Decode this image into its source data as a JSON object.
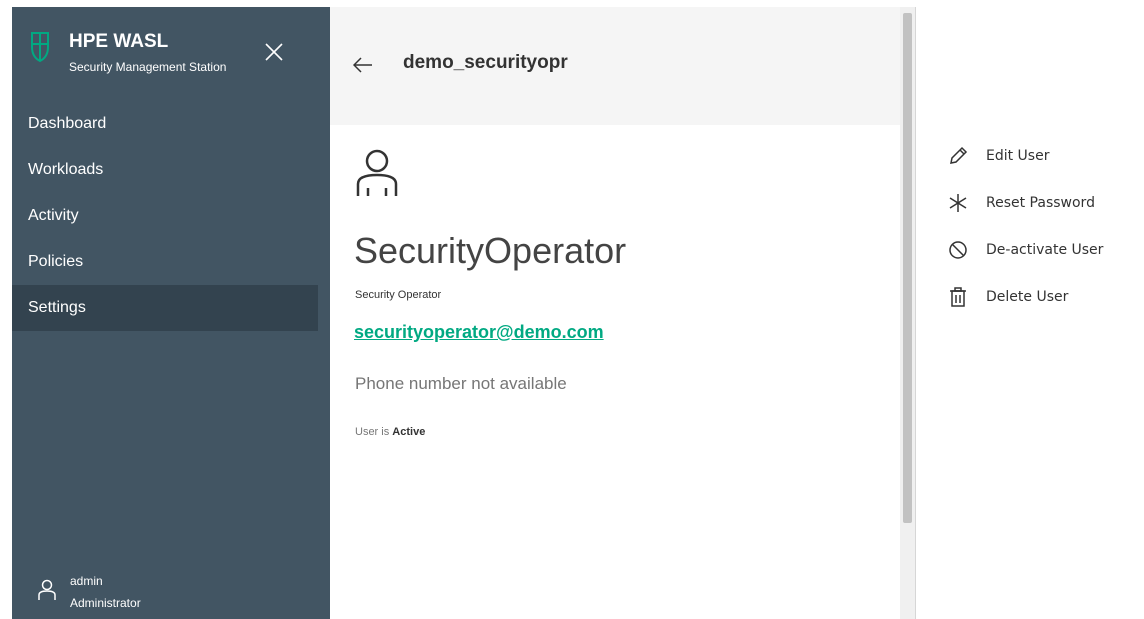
{
  "sidebar": {
    "brand_title": "HPE WASL",
    "brand_subtitle": "Security Management Station",
    "nav": [
      "Dashboard",
      "Workloads",
      "Activity",
      "Policies",
      "Settings"
    ],
    "active_item": "Settings",
    "user": {
      "name": "admin",
      "role": "Administrator"
    }
  },
  "header": {
    "title": "demo_securityopr"
  },
  "profile": {
    "name": "SecurityOperator",
    "role": "Security Operator",
    "email": "securityoperator@demo.com",
    "phone": "Phone number not available",
    "status_prefix": "User is",
    "status": "Active"
  },
  "actions": {
    "edit": "Edit User",
    "reset": "Reset Password",
    "deactivate": "De-activate User",
    "delete": "Delete User"
  },
  "icons": {
    "brand": "shield-icon",
    "close": "close-icon",
    "back": "arrow-left-icon",
    "user": "user-icon",
    "edit": "pencil-icon",
    "reset": "asterisk-icon",
    "deactivate": "block-icon",
    "delete": "trash-icon"
  },
  "colors": {
    "sidebar_bg": "#425563",
    "sidebar_active": "#33434f",
    "accent": "#01a982",
    "header_bg": "#f5f5f5"
  }
}
